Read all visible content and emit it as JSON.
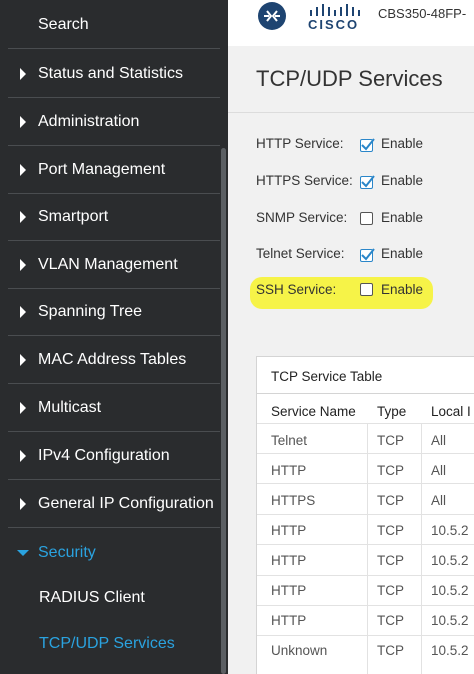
{
  "sidebar": {
    "search_label": "Search",
    "items": [
      {
        "label": "Status and Statistics"
      },
      {
        "label": "Administration"
      },
      {
        "label": "Port Management"
      },
      {
        "label": "Smartport"
      },
      {
        "label": "VLAN Management"
      },
      {
        "label": "Spanning Tree"
      },
      {
        "label": "MAC Address Tables"
      },
      {
        "label": "Multicast"
      },
      {
        "label": "IPv4 Configuration"
      },
      {
        "label": "General IP Configuration"
      }
    ],
    "security": {
      "label": "Security",
      "children": [
        {
          "label": "RADIUS Client"
        },
        {
          "label": "TCP/UDP Services",
          "active": true
        }
      ]
    }
  },
  "header": {
    "brand": "CISCO",
    "device": "CBS350-48FP-"
  },
  "page": {
    "title": "TCP/UDP Services",
    "enable_label": "Enable",
    "services": [
      {
        "label": "HTTP Service:",
        "checked": true
      },
      {
        "label": "HTTPS Service:",
        "checked": true
      },
      {
        "label": "SNMP Service:",
        "checked": false
      },
      {
        "label": "Telnet Service:",
        "checked": true
      },
      {
        "label": "SSH Service:",
        "checked": false
      }
    ]
  },
  "table": {
    "title": "TCP Service Table",
    "columns": [
      "Service Name",
      "Type",
      "Local I"
    ],
    "rows": [
      [
        "Telnet",
        "TCP",
        "All"
      ],
      [
        "HTTP",
        "TCP",
        "All"
      ],
      [
        "HTTPS",
        "TCP",
        "All"
      ],
      [
        "HTTP",
        "TCP",
        "10.5.2"
      ],
      [
        "HTTP",
        "TCP",
        "10.5.2"
      ],
      [
        "HTTP",
        "TCP",
        "10.5.2"
      ],
      [
        "HTTP",
        "TCP",
        "10.5.2"
      ],
      [
        "Unknown",
        "TCP",
        "10.5.2"
      ]
    ]
  },
  "colors": {
    "sidebar_bg": "#2a2c2e",
    "accent_blue": "#2aa3e0",
    "highlight_yellow": "#f7f32a",
    "cisco_navy": "#1e4471"
  }
}
